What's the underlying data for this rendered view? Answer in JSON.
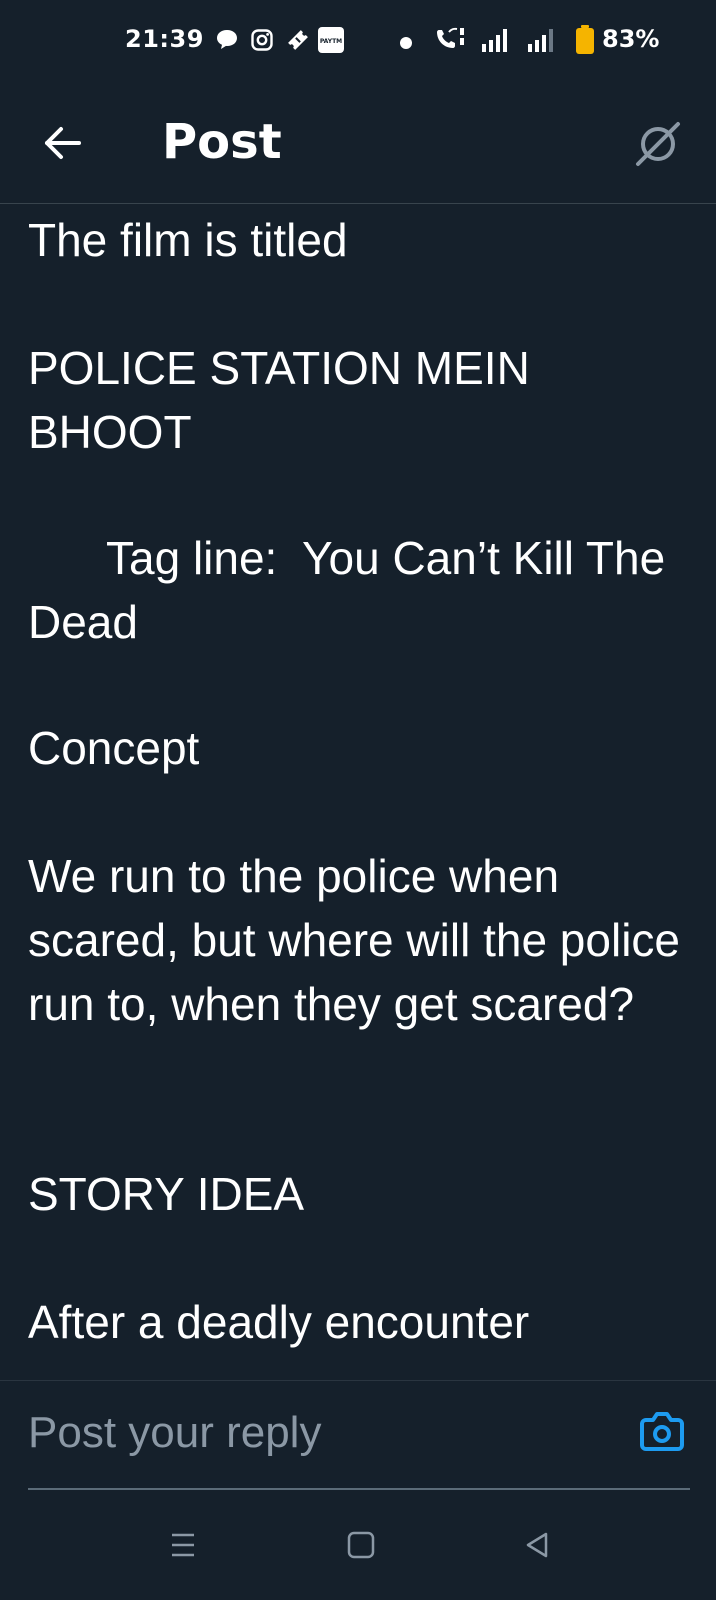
{
  "status_bar": {
    "time": "21:39",
    "battery_percent": "83%",
    "icons": [
      "chat-bubble-icon",
      "instagram-icon",
      "paytm-ticket-icon",
      "paytm-icon",
      "notification-dot",
      "wifi-calling-icon",
      "signal-sim1-icon",
      "signal-sim2-icon",
      "battery-icon"
    ],
    "paytm_label": "PAYTM"
  },
  "header": {
    "title": "Post",
    "back_icon": "arrow-left-icon",
    "grok_icon": "grok-icon"
  },
  "post": {
    "paragraphs": [
      "The film is titled",
      "POLICE STATION MEIN BHOOT",
      "Tag line:  You Can’t Kill The Dead",
      "Concept",
      "We run to the police when scared, but where will the police run to, when they get scared?",
      "STORY IDEA",
      "After a deadly encounter"
    ]
  },
  "reply": {
    "placeholder": "Post your reply",
    "camera_icon": "camera-icon"
  },
  "nav": {
    "recents_icon": "recents-icon",
    "home_icon": "home-icon",
    "back_icon": "back-triangle-icon"
  },
  "colors": {
    "background": "#15202b",
    "text": "#ffffff",
    "placeholder": "#8b98a5",
    "accent": "#1d9bf0",
    "divider": "#38444d",
    "battery": "#f5b400"
  }
}
